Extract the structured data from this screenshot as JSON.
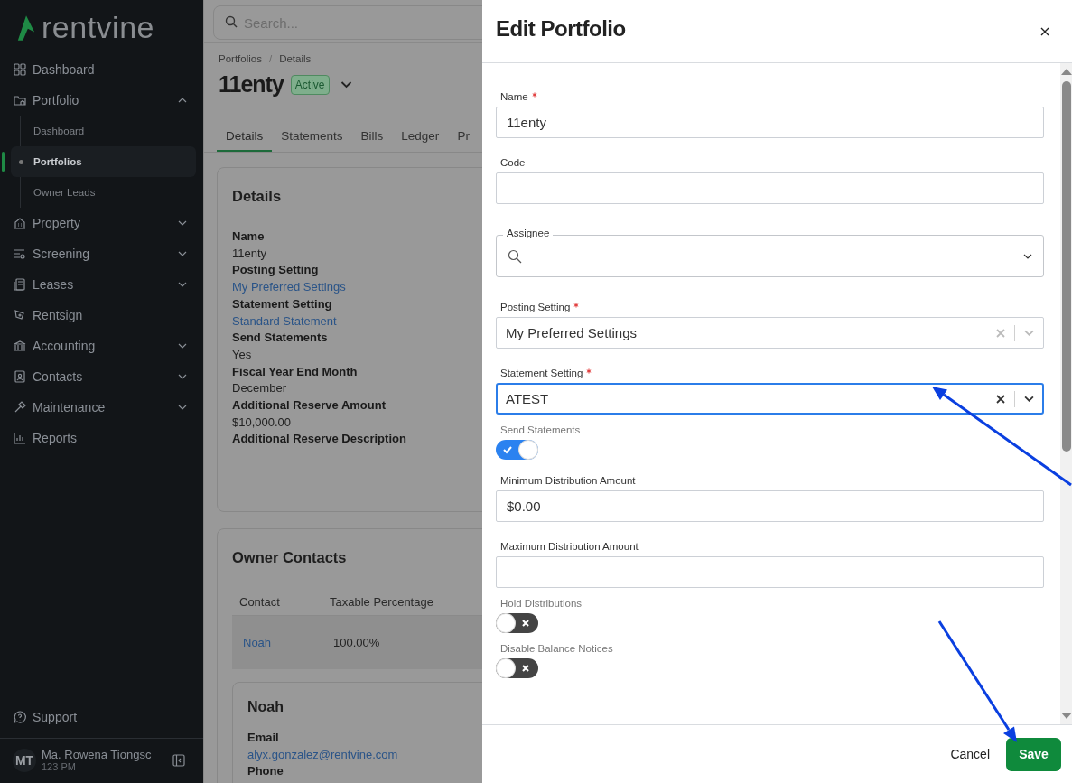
{
  "sidebar": {
    "brand": "rentvine",
    "nav": [
      {
        "label": "Dashboard"
      },
      {
        "label": "Portfolio",
        "expanded": true,
        "children": [
          {
            "label": "Dashboard",
            "selected": false
          },
          {
            "label": "Portfolios",
            "selected": true
          },
          {
            "label": "Owner Leads",
            "selected": false
          }
        ]
      },
      {
        "label": "Property",
        "expanded": false
      },
      {
        "label": "Screening",
        "expanded": false
      },
      {
        "label": "Leases",
        "expanded": false
      },
      {
        "label": "Rentsign"
      },
      {
        "label": "Accounting",
        "expanded": false
      },
      {
        "label": "Contacts",
        "expanded": false
      },
      {
        "label": "Maintenance",
        "expanded": false
      },
      {
        "label": "Reports"
      }
    ],
    "support": "Support",
    "user": {
      "initials": "MT",
      "name": "Ma. Rowena Tiongsc",
      "subtitle": "123 PM"
    }
  },
  "search": {
    "placeholder": "Search..."
  },
  "breadcrumb": {
    "items": [
      "Portfolios",
      "Details"
    ],
    "separator": "/"
  },
  "portfolio": {
    "title": "11enty",
    "status": "Active"
  },
  "tabs": [
    {
      "label": "Details",
      "selected": true
    },
    {
      "label": "Statements",
      "selected": false
    },
    {
      "label": "Bills",
      "selected": false
    },
    {
      "label": "Ledger",
      "selected": false
    },
    {
      "label": "Pr",
      "selected": false
    }
  ],
  "details_card": {
    "title": "Details",
    "fields": [
      {
        "label": "Name",
        "value": "11enty",
        "kind": "text"
      },
      {
        "label": "Posting Setting",
        "value": "My Preferred Settings",
        "kind": "link"
      },
      {
        "label": "Statement Setting",
        "value": "Standard Statement",
        "kind": "link"
      },
      {
        "label": "Send Statements",
        "value": "Yes",
        "kind": "text"
      },
      {
        "label": "Fiscal Year End Month",
        "value": "December",
        "kind": "text"
      },
      {
        "label": "Additional Reserve Amount",
        "value": "$10,000.00",
        "kind": "text"
      },
      {
        "label": "Additional Reserve Description"
      }
    ]
  },
  "owner_contacts": {
    "title": "Owner Contacts",
    "columns": [
      "Contact",
      "Taxable Percentage"
    ],
    "rows": [
      {
        "contact": "Noah",
        "taxable_percentage": "100.00%"
      }
    ],
    "contact_card": {
      "title": "Noah",
      "fields": [
        {
          "label": "Email",
          "value": "alyx.gonzalez@rentvine.com",
          "kind": "link"
        },
        {
          "label": "Phone"
        }
      ]
    }
  },
  "drawer": {
    "title": "Edit Portfolio",
    "fields": [
      {
        "kind": "input",
        "label": "Name",
        "required": true,
        "value": "11enty"
      },
      {
        "kind": "input",
        "label": "Code",
        "required": false
      },
      {
        "kind": "search-select",
        "label": "Assignee"
      },
      {
        "kind": "select",
        "label": "Posting Setting",
        "required": true,
        "value": "My Preferred Settings",
        "focused": false
      },
      {
        "kind": "select",
        "label": "Statement Setting",
        "required": true,
        "value": "ATEST",
        "focused": true
      },
      {
        "kind": "toggle",
        "label": "Send Statements",
        "on": true
      },
      {
        "kind": "input",
        "label": "Minimum Distribution Amount",
        "required": false,
        "value": "$0.00"
      },
      {
        "kind": "input",
        "label": "Maximum Distribution Amount",
        "required": false
      },
      {
        "kind": "toggle",
        "label": "Hold Distributions",
        "on": false
      },
      {
        "kind": "toggle",
        "label": "Disable Balance Notices",
        "on": false
      }
    ],
    "cancel": "Cancel",
    "save": "Save"
  }
}
